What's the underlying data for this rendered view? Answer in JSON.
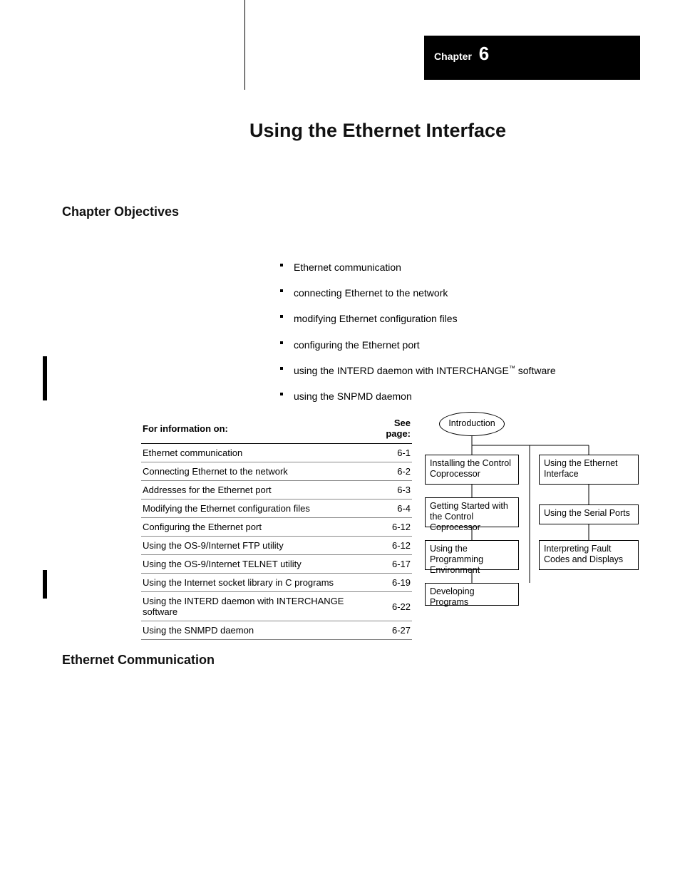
{
  "chapter_label": "Chapter",
  "chapter_number": "6",
  "title": "Using the Ethernet Interface",
  "sections": {
    "objectives": "Chapter Objectives",
    "ethernet": "Ethernet Communication"
  },
  "bullets": [
    "Ethernet communication",
    "connecting Ethernet to the network",
    "modifying Ethernet configuration files",
    "configuring the Ethernet port",
    {
      "pre": "using the INTERD daemon with INTERCHANGE",
      "tm": "™",
      "post": " software"
    },
    "using the SNPMD daemon"
  ],
  "table": {
    "headers": [
      "For information on:",
      "See page:"
    ],
    "rows": [
      [
        "Ethernet communication",
        "6-1"
      ],
      [
        "Connecting Ethernet to the network",
        "6-2"
      ],
      [
        "Addresses for the Ethernet port",
        "6-3"
      ],
      [
        "Modifying the Ethernet configuration files",
        "6-4"
      ],
      [
        "Configuring the Ethernet port",
        "6-12"
      ],
      [
        "Using the OS-9/Internet FTP utility",
        "6-12"
      ],
      [
        "Using the OS-9/Internet TELNET utility",
        "6-17"
      ],
      [
        "Using the Internet socket library in C programs",
        "6-19"
      ],
      [
        "Using the INTERD daemon with INTERCHANGE software",
        "6-22"
      ],
      [
        "Using the SNMPD daemon",
        "6-27"
      ]
    ]
  },
  "flow": {
    "intro": "Introduction",
    "left": [
      "Installing the Control Coprocessor",
      "Getting Started with the Control Coprocessor",
      "Using the Programming Environment",
      "Developing Programs"
    ],
    "right": [
      "Using the Ethernet Interface",
      "Using the Serial Ports",
      "Interpreting Fault Codes and Displays"
    ]
  }
}
